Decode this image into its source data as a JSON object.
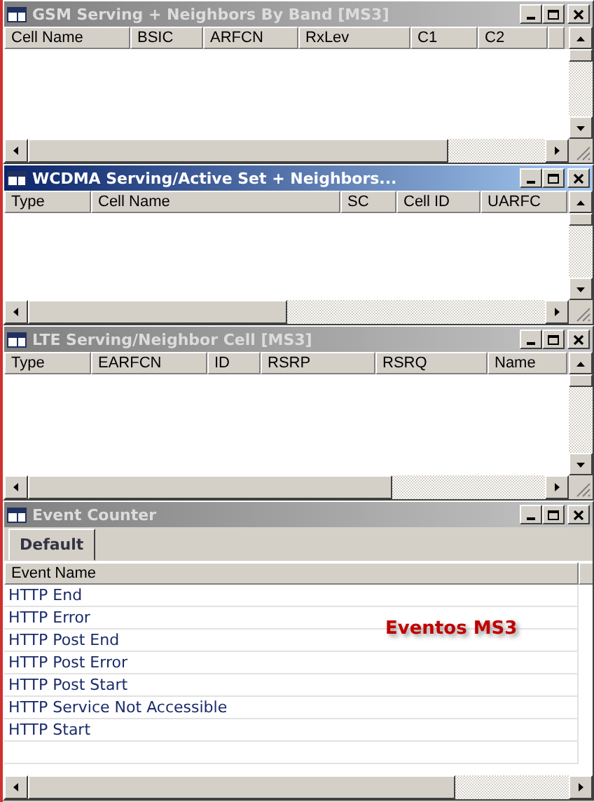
{
  "windows": [
    {
      "kind": "list",
      "title": "GSM Serving + Neighbors By Band [MS3]",
      "active": false,
      "columns": [
        "Cell Name",
        "BSIC",
        "ARFCN",
        "RxLev",
        "C1",
        "C2",
        ""
      ]
    },
    {
      "kind": "list",
      "title": "WCDMA Serving/Active Set + Neighbors...",
      "active": true,
      "columns": [
        "Type",
        "Cell Name",
        "SC",
        "Cell ID",
        "UARFC"
      ]
    },
    {
      "kind": "list",
      "title": "LTE Serving/Neighbor Cell [MS3]",
      "active": false,
      "columns": [
        "Type",
        "EARFCN",
        "ID",
        "RSRP",
        "RSRQ",
        "Name"
      ]
    },
    {
      "kind": "event_counter",
      "title": "Event Counter",
      "active": false,
      "tabs": [
        {
          "label": "Default",
          "selected": true
        }
      ],
      "columns": [
        "Event Name",
        ""
      ],
      "rows": [
        "HTTP End",
        "HTTP Error",
        "HTTP Post End",
        "HTTP Post Error",
        "HTTP Post Start",
        "HTTP Service Not Accessible",
        "HTTP Start"
      ],
      "annotation": "Eventos MS3"
    }
  ]
}
